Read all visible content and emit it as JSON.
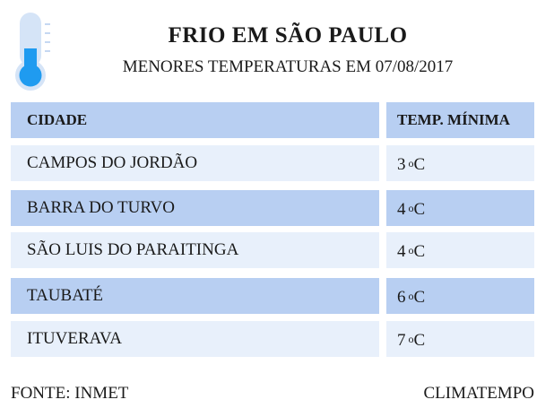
{
  "header": {
    "title": "FRIO EM SÃO PAULO",
    "subtitle": "MENORES TEMPERATURAS EM 07/08/2017",
    "icon": "thermometer-icon"
  },
  "table": {
    "columns": [
      "CIDADE",
      "TEMP. MÍNIMA"
    ],
    "rows": [
      {
        "city": "CAMPOS DO JORDÃO",
        "temp": "3",
        "unit_deg": "o",
        "unit": "C"
      },
      {
        "city": "BARRA DO TURVO",
        "temp": "4",
        "unit_deg": "o",
        "unit": "C"
      },
      {
        "city": "SÃO LUIS DO PARAITINGA",
        "temp": "4",
        "unit_deg": "o",
        "unit": "C"
      },
      {
        "city": "TAUBATÉ",
        "temp": "6",
        "unit_deg": "o",
        "unit": "C"
      },
      {
        "city": "ITUVERAVA",
        "temp": "7",
        "unit_deg": "o",
        "unit": "C"
      }
    ]
  },
  "footer": {
    "source": "FONTE: INMET",
    "credit": "CLIMATEMPO"
  },
  "colors": {
    "header_row": "#b8cff2",
    "row_dark": "#b8cff2",
    "row_light": "#e8f0fb",
    "thermometer_fill": "#1f9bf0",
    "thermometer_tube": "#d5e4f7"
  }
}
